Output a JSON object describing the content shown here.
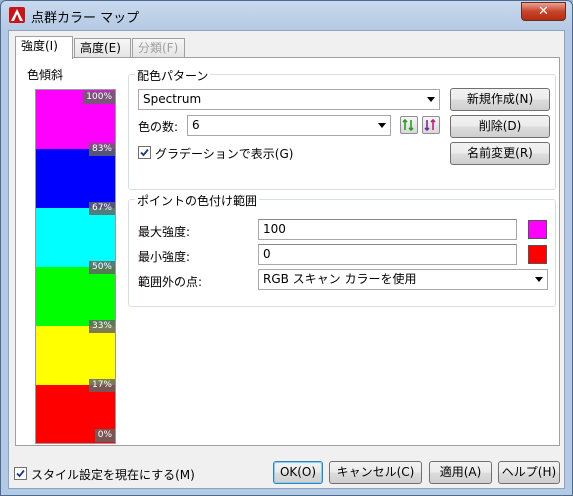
{
  "window": {
    "title": "点群カラー マップ",
    "close_label": "✕"
  },
  "tabs": [
    {
      "label": "強度(I)",
      "state": "active"
    },
    {
      "label": "高度(E)",
      "state": "normal"
    },
    {
      "label": "分類(F)",
      "state": "disabled"
    }
  ],
  "gradient_group": {
    "title": "色傾斜",
    "bands": [
      {
        "color": "#ff00ff",
        "label": "100%"
      },
      {
        "color": "#0000ff",
        "label": "83%"
      },
      {
        "color": "#00ffff",
        "label": "67%"
      },
      {
        "color": "#00ff00",
        "label": "50%"
      },
      {
        "color": "#ffff00",
        "label": "33%"
      },
      {
        "color": "#ff0000",
        "label": "17%"
      }
    ],
    "bottom_label": "0%"
  },
  "scheme_group": {
    "title": "配色パターン",
    "scheme_value": "Spectrum",
    "color_count_label": "色の数:",
    "color_count_value": "6",
    "gradient_checkbox_label": "グラデーションで表示(G)",
    "gradient_checkbox_checked": true,
    "new_button": "新規作成(N)",
    "delete_button": "削除(D)",
    "rename_button": "名前変更(R)"
  },
  "range_group": {
    "title": "ポイントの色付け範囲",
    "max_label": "最大強度:",
    "max_value": "100",
    "max_color": "#ff00ff",
    "min_label": "最小強度:",
    "min_value": "0",
    "min_color": "#ff0000",
    "outside_label": "範囲外の点:",
    "outside_value": "RGB スキャン カラーを使用"
  },
  "footer": {
    "style_checkbox_label": "スタイル設定を現在にする(M)",
    "style_checkbox_checked": true,
    "ok_button": "OK(O)",
    "cancel_button": "キャンセル(C)",
    "apply_button": "適用(A)",
    "help_button": "ヘルプ(H)"
  }
}
